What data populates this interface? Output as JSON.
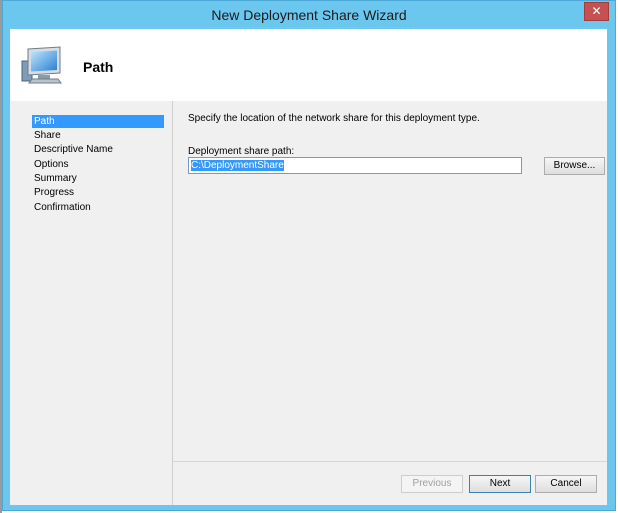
{
  "window": {
    "title": "New Deployment Share Wizard",
    "close_glyph": "✕"
  },
  "header": {
    "title": "Path",
    "icon": "computer-monitor-icon"
  },
  "nav": {
    "items": [
      {
        "label": "Path",
        "active": true
      },
      {
        "label": "Share",
        "active": false
      },
      {
        "label": "Descriptive Name",
        "active": false
      },
      {
        "label": "Options",
        "active": false
      },
      {
        "label": "Summary",
        "active": false
      },
      {
        "label": "Progress",
        "active": false
      },
      {
        "label": "Confirmation",
        "active": false
      }
    ]
  },
  "content": {
    "description": "Specify the location of the network share for this deployment type.",
    "path_label": "Deployment share path:",
    "path_value": "C:\\DeploymentShare",
    "browse_label": "Browse..."
  },
  "footer": {
    "previous_label": "Previous",
    "next_label": "Next",
    "cancel_label": "Cancel"
  },
  "colors": {
    "window_frame": "#6cc7ef",
    "selection": "#3399ff",
    "close_button": "#c75050"
  }
}
